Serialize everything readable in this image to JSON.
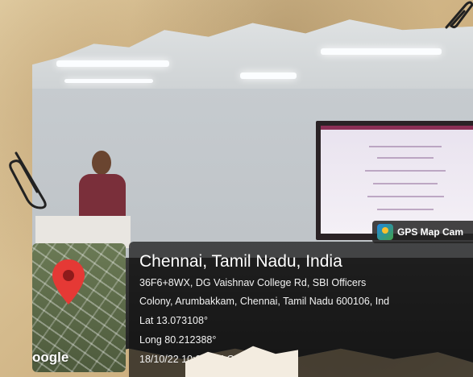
{
  "badge": {
    "label": "GPS Map Cam"
  },
  "location": {
    "title": "Chennai, Tamil Nadu, India",
    "address_line1": "36F6+8WX, DG Vaishnav College Rd, SBI Officers",
    "address_line2": "Colony, Arumbakkam, Chennai, Tamil Nadu 600106, Ind",
    "latitude": "Lat 13.073108°",
    "longitude": "Long 80.212388°",
    "timestamp": "18/10/22 10:02 AM GMT"
  },
  "map": {
    "watermark": "oogle",
    "pin_color": "#e53935"
  },
  "icons": [
    "paperclip-icon",
    "map-pin-icon",
    "gps-map-cam-icon"
  ]
}
